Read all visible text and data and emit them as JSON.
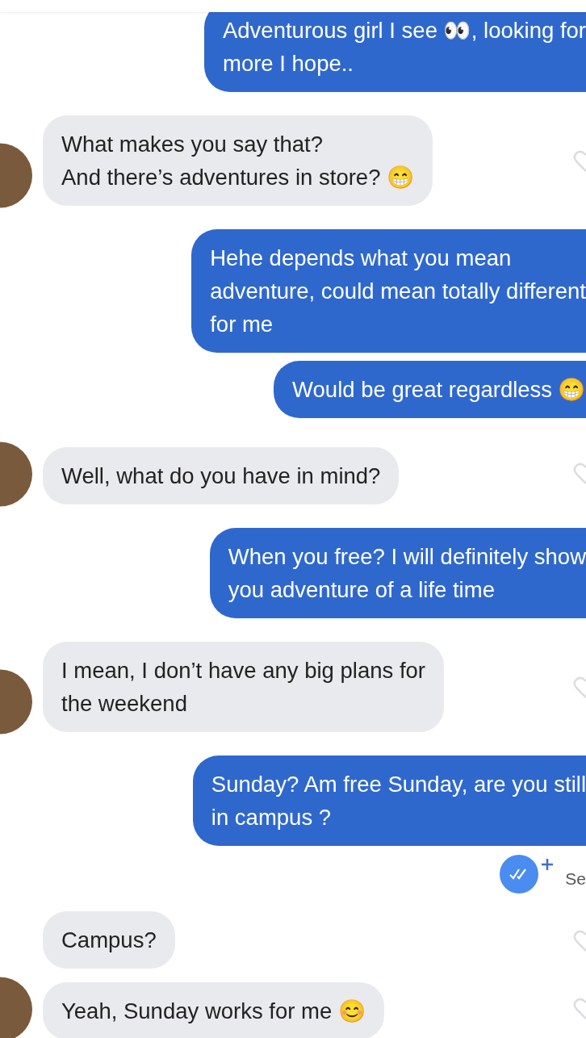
{
  "items": [
    {
      "kind": "sent",
      "text": "Adventurous girl I see 👀, looking for\nmore I hope.."
    },
    {
      "kind": "received",
      "avatar": true,
      "text": "What makes you say that?\nAnd there’s adventures in store? 😁"
    },
    {
      "kind": "sent",
      "text": "Hehe depends what you mean\nadventure, could mean totally different\nfor me"
    },
    {
      "kind": "sent",
      "text": "Would be great regardless 😁"
    },
    {
      "kind": "received",
      "avatar": true,
      "text": "Well, what do you have in mind?"
    },
    {
      "kind": "sent",
      "text": "When you free? I will definitely show\nyou adventure of a life time"
    },
    {
      "kind": "received",
      "avatar": true,
      "text": "I mean, I don’t have any big plans for\nthe weekend"
    },
    {
      "kind": "sent",
      "text": "Sunday? Am free Sunday, are you still\nin campus ?"
    },
    {
      "kind": "receipt",
      "label": "Se"
    },
    {
      "kind": "received",
      "avatar": false,
      "text": "Campus?"
    },
    {
      "kind": "received",
      "avatar": true,
      "text": "Yeah, Sunday works for me 😊"
    }
  ]
}
